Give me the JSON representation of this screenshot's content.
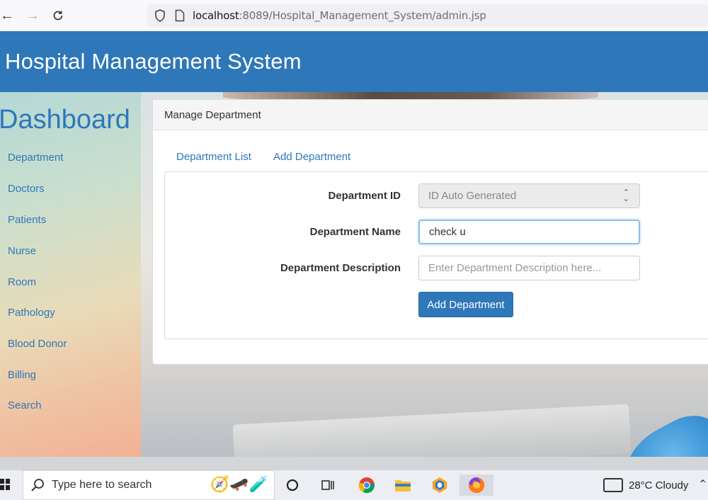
{
  "browser": {
    "url_host": "localhost",
    "url_rest": ":8089/Hospital_Management_System/admin.jsp",
    "back_icon": "arrow-left-icon",
    "forward_icon": "arrow-right-icon",
    "reload_icon": "reload-icon"
  },
  "header": {
    "title": "Hospital Management System",
    "bg_color": "#2e77b9"
  },
  "sidebar": {
    "title": "Dashboard",
    "items": [
      {
        "label": "Department"
      },
      {
        "label": "Doctors"
      },
      {
        "label": "Patients"
      },
      {
        "label": "Nurse"
      },
      {
        "label": "Room"
      },
      {
        "label": "Pathology"
      },
      {
        "label": "Blood Donor"
      },
      {
        "label": "Billing"
      },
      {
        "label": "Search"
      }
    ]
  },
  "panel": {
    "heading": "Manage Department",
    "tabs": [
      {
        "label": "Department List"
      },
      {
        "label": "Add Department"
      }
    ],
    "form": {
      "id_label": "Department ID",
      "id_value": "ID Auto Generated",
      "name_label": "Department Name",
      "name_value": "check u",
      "desc_label": "Department Description",
      "desc_placeholder": "Enter Department Description here...",
      "submit_label": "Add Department"
    }
  },
  "taskbar": {
    "search_placeholder": "Type here to search",
    "weather": "28°C  Cloudy"
  }
}
